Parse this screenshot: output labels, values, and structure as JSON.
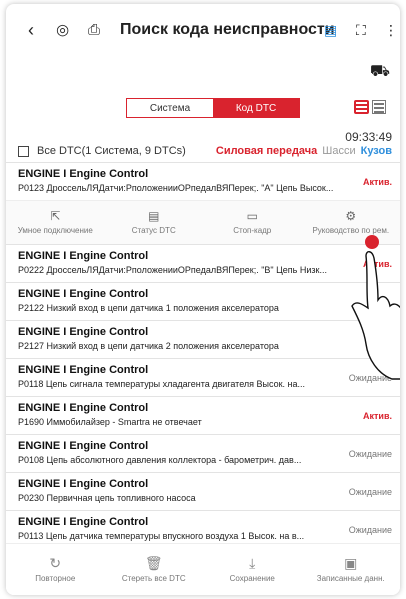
{
  "header": {
    "back_icon": "chevron-left-icon",
    "title": "Поиск кода неисправности",
    "sub_icon": "car-icon"
  },
  "segment": {
    "left": "Система",
    "right": "Код DTC"
  },
  "time": "09:33:49",
  "summary": "Все DTC(1 Система, 9 DTCs)",
  "system_tabs": [
    "Силовая передача",
    "Шасси",
    "Кузов"
  ],
  "rows": [
    {
      "sys": "ENGINE I Engine Control",
      "desc": "P0123 ДроссельЛЯДатчи:РположенииОРпедалВЯПерек;. \"A\" Цепь Высок...",
      "status": "Актив."
    },
    {
      "sys": "ENGINE I Engine Control",
      "desc": "P0222 ДроссельЛЯДатчи:РположенииОРпедалВЯПерек;. \"B\" Цепь Низк...",
      "status": "Актив."
    },
    {
      "sys": "ENGINE I Engine Control",
      "desc": "P2122 Низкий вход в цепи датчика 1 положения акселератора",
      "status": ""
    },
    {
      "sys": "ENGINE I Engine Control",
      "desc": "P2127 Низкий вход в цепи датчика 2 положения акселератора",
      "status": ""
    },
    {
      "sys": "ENGINE I Engine Control",
      "desc": "P0118 Цепь сигнала температуры хладагента двигателя Высок. на...",
      "status": "Ожидание"
    },
    {
      "sys": "ENGINE I Engine Control",
      "desc": "P1690 Иммобилайзер - Smartra не отвечает",
      "status": "Актив."
    },
    {
      "sys": "ENGINE I Engine Control",
      "desc": "P0108 Цепь абсолютного давления коллектора - барометрич. дав...",
      "status": "Ожидание"
    },
    {
      "sys": "ENGINE I Engine Control",
      "desc": "P0230 Первичная цепь топливного насоса",
      "status": "Ожидание"
    },
    {
      "sys": "ENGINE I Engine Control",
      "desc": "P0113 Цепь датчика температуры впускного воздуха 1 Высок. на в...",
      "status": "Ожидание"
    }
  ],
  "row_actions": [
    "Умное подключение",
    "Статус DTC",
    "Стоп-кадр",
    "Руководство по рем."
  ],
  "toolbar": [
    "Повторное",
    "Стереть все DTC",
    "Сохранение",
    "Записанные данн."
  ]
}
